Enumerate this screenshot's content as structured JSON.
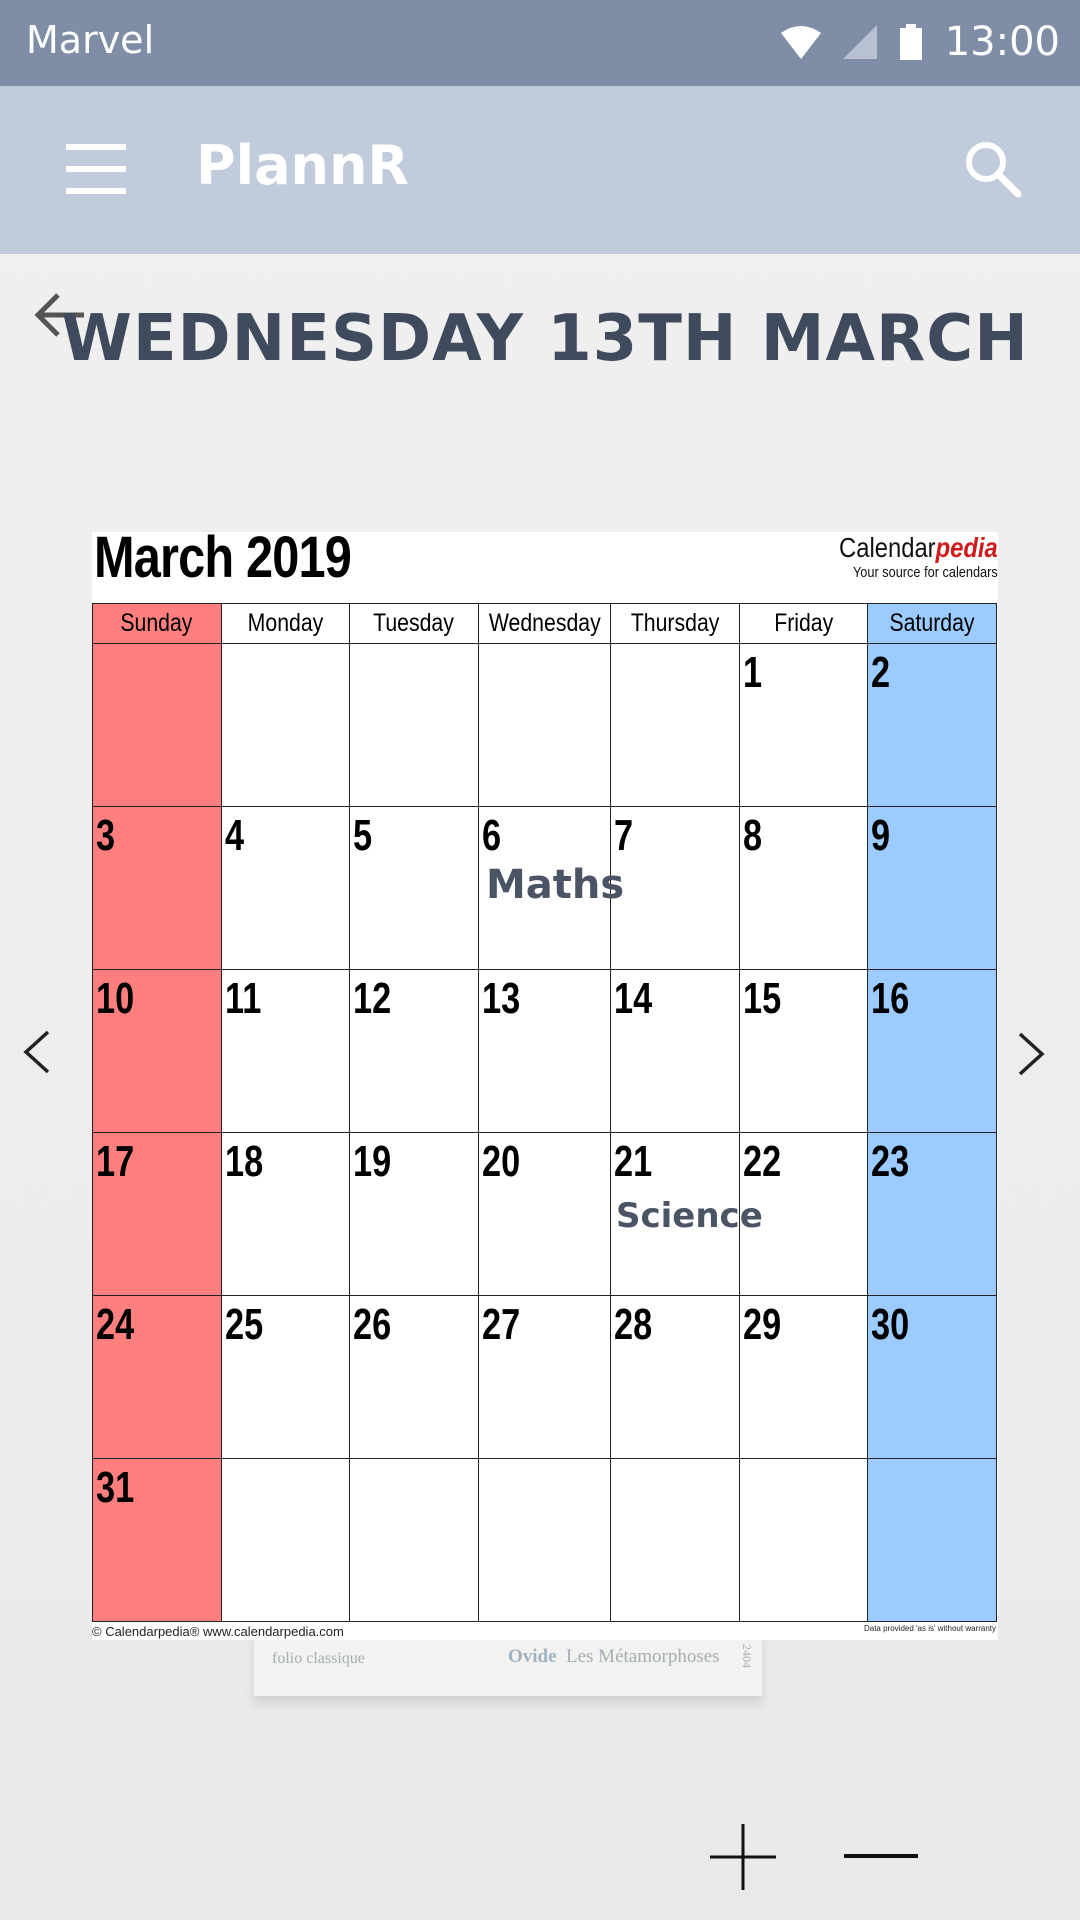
{
  "status_bar": {
    "carrier": "Marvel",
    "time": "13:00",
    "icons": [
      "wifi-icon",
      "signal-icon",
      "battery-icon"
    ]
  },
  "app_bar": {
    "title": "PlannR",
    "menu_icon": "menu-icon",
    "search_icon": "search-icon",
    "color": "#c0ccdb"
  },
  "page": {
    "title": "WEDNESDAY 13TH MARCH",
    "back_icon": "arrow-left-icon"
  },
  "calendar": {
    "month_title": "March 2019",
    "logo_main_prefix": "Calendar",
    "logo_main_suffix": "pedia",
    "logo_sub": "Your source for calendars",
    "days": [
      "Sunday",
      "Monday",
      "Tuesday",
      "Wednesday",
      "Thursday",
      "Friday",
      "Saturday"
    ],
    "weeks": [
      [
        "",
        "",
        "",
        "",
        "",
        "1",
        "2"
      ],
      [
        "3",
        "4",
        "5",
        "6",
        "7",
        "8",
        "9"
      ],
      [
        "10",
        "11",
        "12",
        "13",
        "14",
        "15",
        "16"
      ],
      [
        "17",
        "18",
        "19",
        "20",
        "21",
        "22",
        "23"
      ],
      [
        "24",
        "25",
        "26",
        "27",
        "28",
        "29",
        "30"
      ],
      [
        "31",
        "",
        "",
        "",
        "",
        "",
        ""
      ]
    ],
    "footer_left": "© Calendarpedia®   www.calendarpedia.com",
    "footer_right": "Data provided 'as is' without warranty",
    "sunday_color": "#ff7f7f",
    "saturday_color": "#9bcbff"
  },
  "events": [
    {
      "label": "Maths",
      "date": "6"
    },
    {
      "label": "Science",
      "date": "21"
    }
  ],
  "book": {
    "folio": "folio classique",
    "author": "Ovide",
    "title": "Les Métamorphoses",
    "code": "2404"
  },
  "navigation": {
    "prev_icon": "chevron-left-icon",
    "next_icon": "chevron-right-icon",
    "add_icon": "plus-icon",
    "remove_icon": "minus-icon"
  }
}
